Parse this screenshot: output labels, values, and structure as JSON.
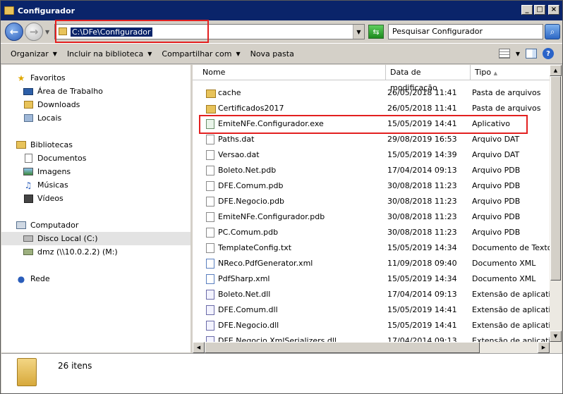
{
  "window": {
    "title": "Configurador"
  },
  "address": {
    "path": "C:\\DFe\\Configurador"
  },
  "search": {
    "placeholder": "Pesquisar Configurador"
  },
  "toolbar": {
    "organize": "Organizar",
    "include_library": "Incluir na biblioteca",
    "share_with": "Compartilhar com",
    "new_folder": "Nova pasta"
  },
  "nav": {
    "favorites": "Favoritos",
    "desktop": "Área de Trabalho",
    "downloads": "Downloads",
    "places": "Locais",
    "libraries": "Bibliotecas",
    "documents": "Documentos",
    "images": "Imagens",
    "music": "Músicas",
    "videos": "Vídeos",
    "computer": "Computador",
    "local_disk": "Disco Local (C:)",
    "network_drive": "dmz (\\\\10.0.2.2) (M:)",
    "network": "Rede"
  },
  "columns": {
    "name": "Nome",
    "modified": "Data de modificação",
    "type": "Tipo"
  },
  "files": [
    {
      "name": "cache",
      "date": "26/05/2018 11:41",
      "type": "Pasta de arquivos",
      "icon": "folder"
    },
    {
      "name": "Certificados2017",
      "date": "26/05/2018 11:41",
      "type": "Pasta de arquivos",
      "icon": "folder"
    },
    {
      "name": "EmiteNFe.Configurador.exe",
      "date": "15/05/2019 14:41",
      "type": "Aplicativo",
      "icon": "exe"
    },
    {
      "name": "Paths.dat",
      "date": "29/08/2019 16:53",
      "type": "Arquivo DAT",
      "icon": "doc"
    },
    {
      "name": "Versao.dat",
      "date": "15/05/2019 14:39",
      "type": "Arquivo DAT",
      "icon": "doc"
    },
    {
      "name": "Boleto.Net.pdb",
      "date": "17/04/2014 09:13",
      "type": "Arquivo PDB",
      "icon": "doc"
    },
    {
      "name": "DFE.Comum.pdb",
      "date": "30/08/2018 11:23",
      "type": "Arquivo PDB",
      "icon": "doc"
    },
    {
      "name": "DFE.Negocio.pdb",
      "date": "30/08/2018 11:23",
      "type": "Arquivo PDB",
      "icon": "doc"
    },
    {
      "name": "EmiteNFe.Configurador.pdb",
      "date": "30/08/2018 11:23",
      "type": "Arquivo PDB",
      "icon": "doc"
    },
    {
      "name": "PC.Comum.pdb",
      "date": "30/08/2018 11:23",
      "type": "Arquivo PDB",
      "icon": "doc"
    },
    {
      "name": "TemplateConfig.txt",
      "date": "15/05/2019 14:34",
      "type": "Documento de Texto",
      "icon": "doc"
    },
    {
      "name": "NReco.PdfGenerator.xml",
      "date": "11/09/2018 09:40",
      "type": "Documento XML",
      "icon": "xml"
    },
    {
      "name": "PdfSharp.xml",
      "date": "15/05/2019 14:34",
      "type": "Documento XML",
      "icon": "xml"
    },
    {
      "name": "Boleto.Net.dll",
      "date": "17/04/2014 09:13",
      "type": "Extensão de aplicativo",
      "icon": "dll"
    },
    {
      "name": "DFE.Comum.dll",
      "date": "15/05/2019 14:41",
      "type": "Extensão de aplicativo",
      "icon": "dll"
    },
    {
      "name": "DFE.Negocio.dll",
      "date": "15/05/2019 14:41",
      "type": "Extensão de aplicativo",
      "icon": "dll"
    },
    {
      "name": "DFE.Negocio.XmlSerializers.dll",
      "date": "17/04/2014 09:13",
      "type": "Extensão de aplicativo",
      "icon": "dll"
    }
  ],
  "details": {
    "count": "26 itens"
  }
}
